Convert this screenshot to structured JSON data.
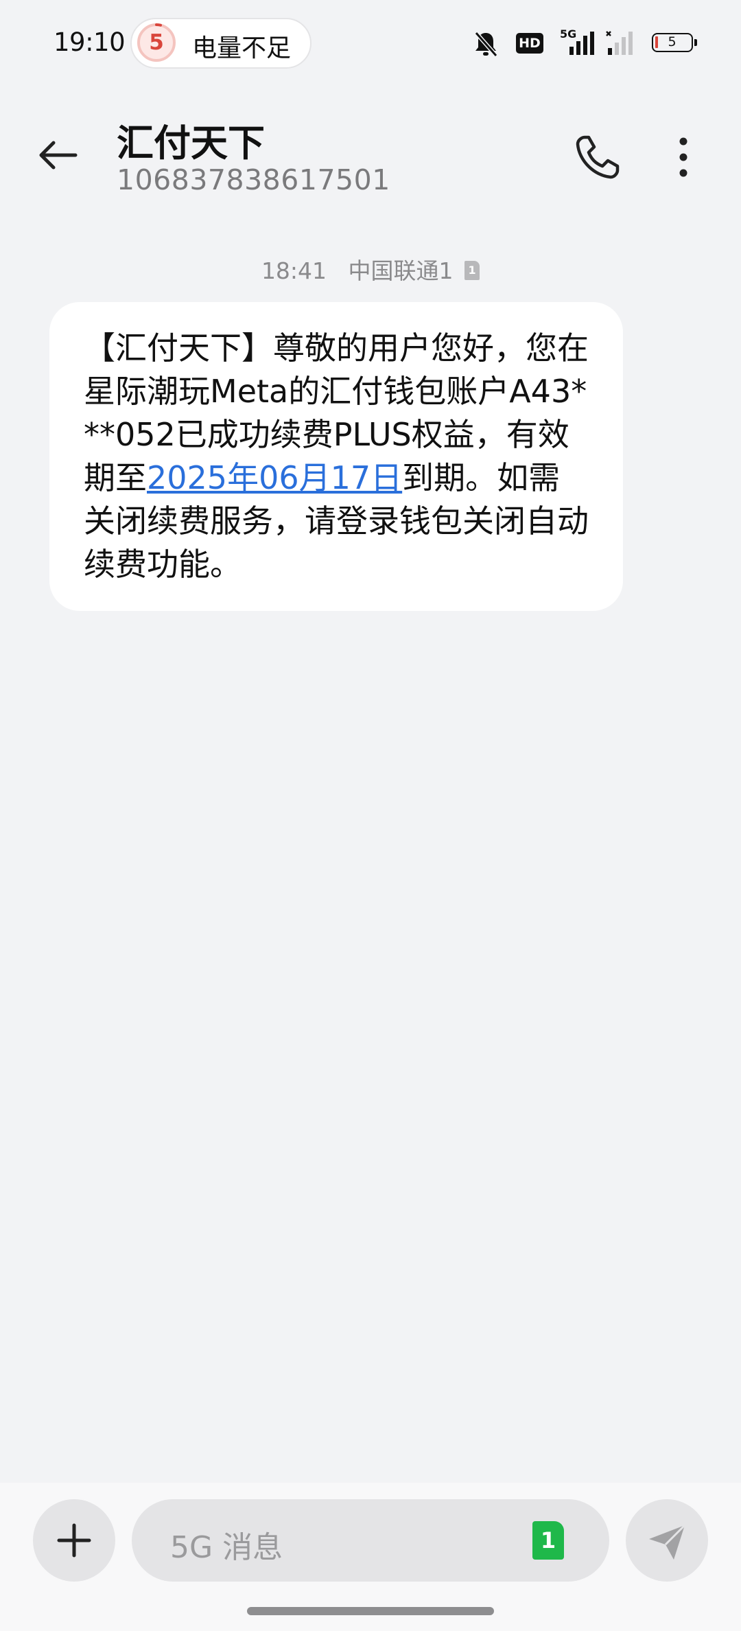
{
  "status_bar": {
    "time": "19:10",
    "battery_alert_level": "5",
    "battery_alert_text": "电量不足",
    "hd_label": "HD",
    "network_label": "5G",
    "battery_level": "5"
  },
  "header": {
    "contact_name": "汇付天下",
    "contact_number": "106837838617501"
  },
  "message": {
    "time": "18:41",
    "carrier": "中国联通1",
    "sim_number": "1",
    "text_before_link": "【汇付天下】尊敬的用户您好，您在星际潮玩Meta的汇付钱包账户A43***052已成功续费PLUS权益，有效期至",
    "link_text": "2025年06月17日",
    "text_after_link": "到期。如需关闭续费服务，请登录钱包关闭自动续费功能。"
  },
  "compose": {
    "placeholder": "5G 消息",
    "sim_badge": "1"
  },
  "colors": {
    "background": "#f2f3f5",
    "bubble": "#ffffff",
    "link": "#2a6fdb",
    "sim_badge": "#1fb84a",
    "battery_alert": "#d9453b"
  },
  "icons": [
    "back-arrow-icon",
    "phone-icon",
    "more-vertical-icon",
    "plus-icon",
    "send-icon",
    "bell-muted-icon",
    "signal-icon",
    "battery-icon"
  ]
}
